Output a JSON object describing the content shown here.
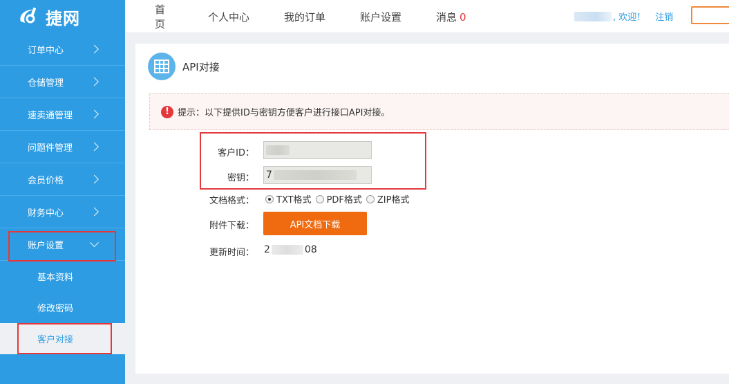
{
  "logo": {
    "name": "捷网",
    "icon": "logo-swoosh-icon"
  },
  "nav": {
    "items": [
      "首页",
      "个人中心",
      "我的订单",
      "账户设置",
      "消息"
    ],
    "message_count": "0"
  },
  "user": {
    "welcome": ", 欢迎！",
    "logout": "注销"
  },
  "sidebar": {
    "items": [
      {
        "label": "订单中心"
      },
      {
        "label": "仓储管理"
      },
      {
        "label": "速卖通管理"
      },
      {
        "label": "问题件管理"
      },
      {
        "label": "会员价格"
      },
      {
        "label": "财务中心"
      },
      {
        "label": "账户设置"
      }
    ],
    "sub_items": [
      {
        "label": "基本资料"
      },
      {
        "label": "修改密码"
      },
      {
        "label": "客户对接"
      }
    ]
  },
  "panel": {
    "title": "API对接",
    "icon": "table-grid-icon",
    "notice": "提示：以下提供ID与密钥方便客户进行接口API对接。",
    "form": {
      "customer_id_label": "客户ID：",
      "secret_label": "密钥：",
      "secret_prefix": "7",
      "format_label": "文档格式：",
      "formats": [
        "TXT格式",
        "PDF格式",
        "ZIP格式"
      ],
      "selected_format": "TXT格式",
      "attachment_label": "附件下载：",
      "download_button": "API文档下载",
      "update_label": "更新时间：",
      "update_prefix": "2",
      "update_suffix": "08"
    }
  },
  "colors": {
    "primary": "#2e9ce3",
    "accent": "#f06a0f",
    "alert": "#e5383b"
  }
}
